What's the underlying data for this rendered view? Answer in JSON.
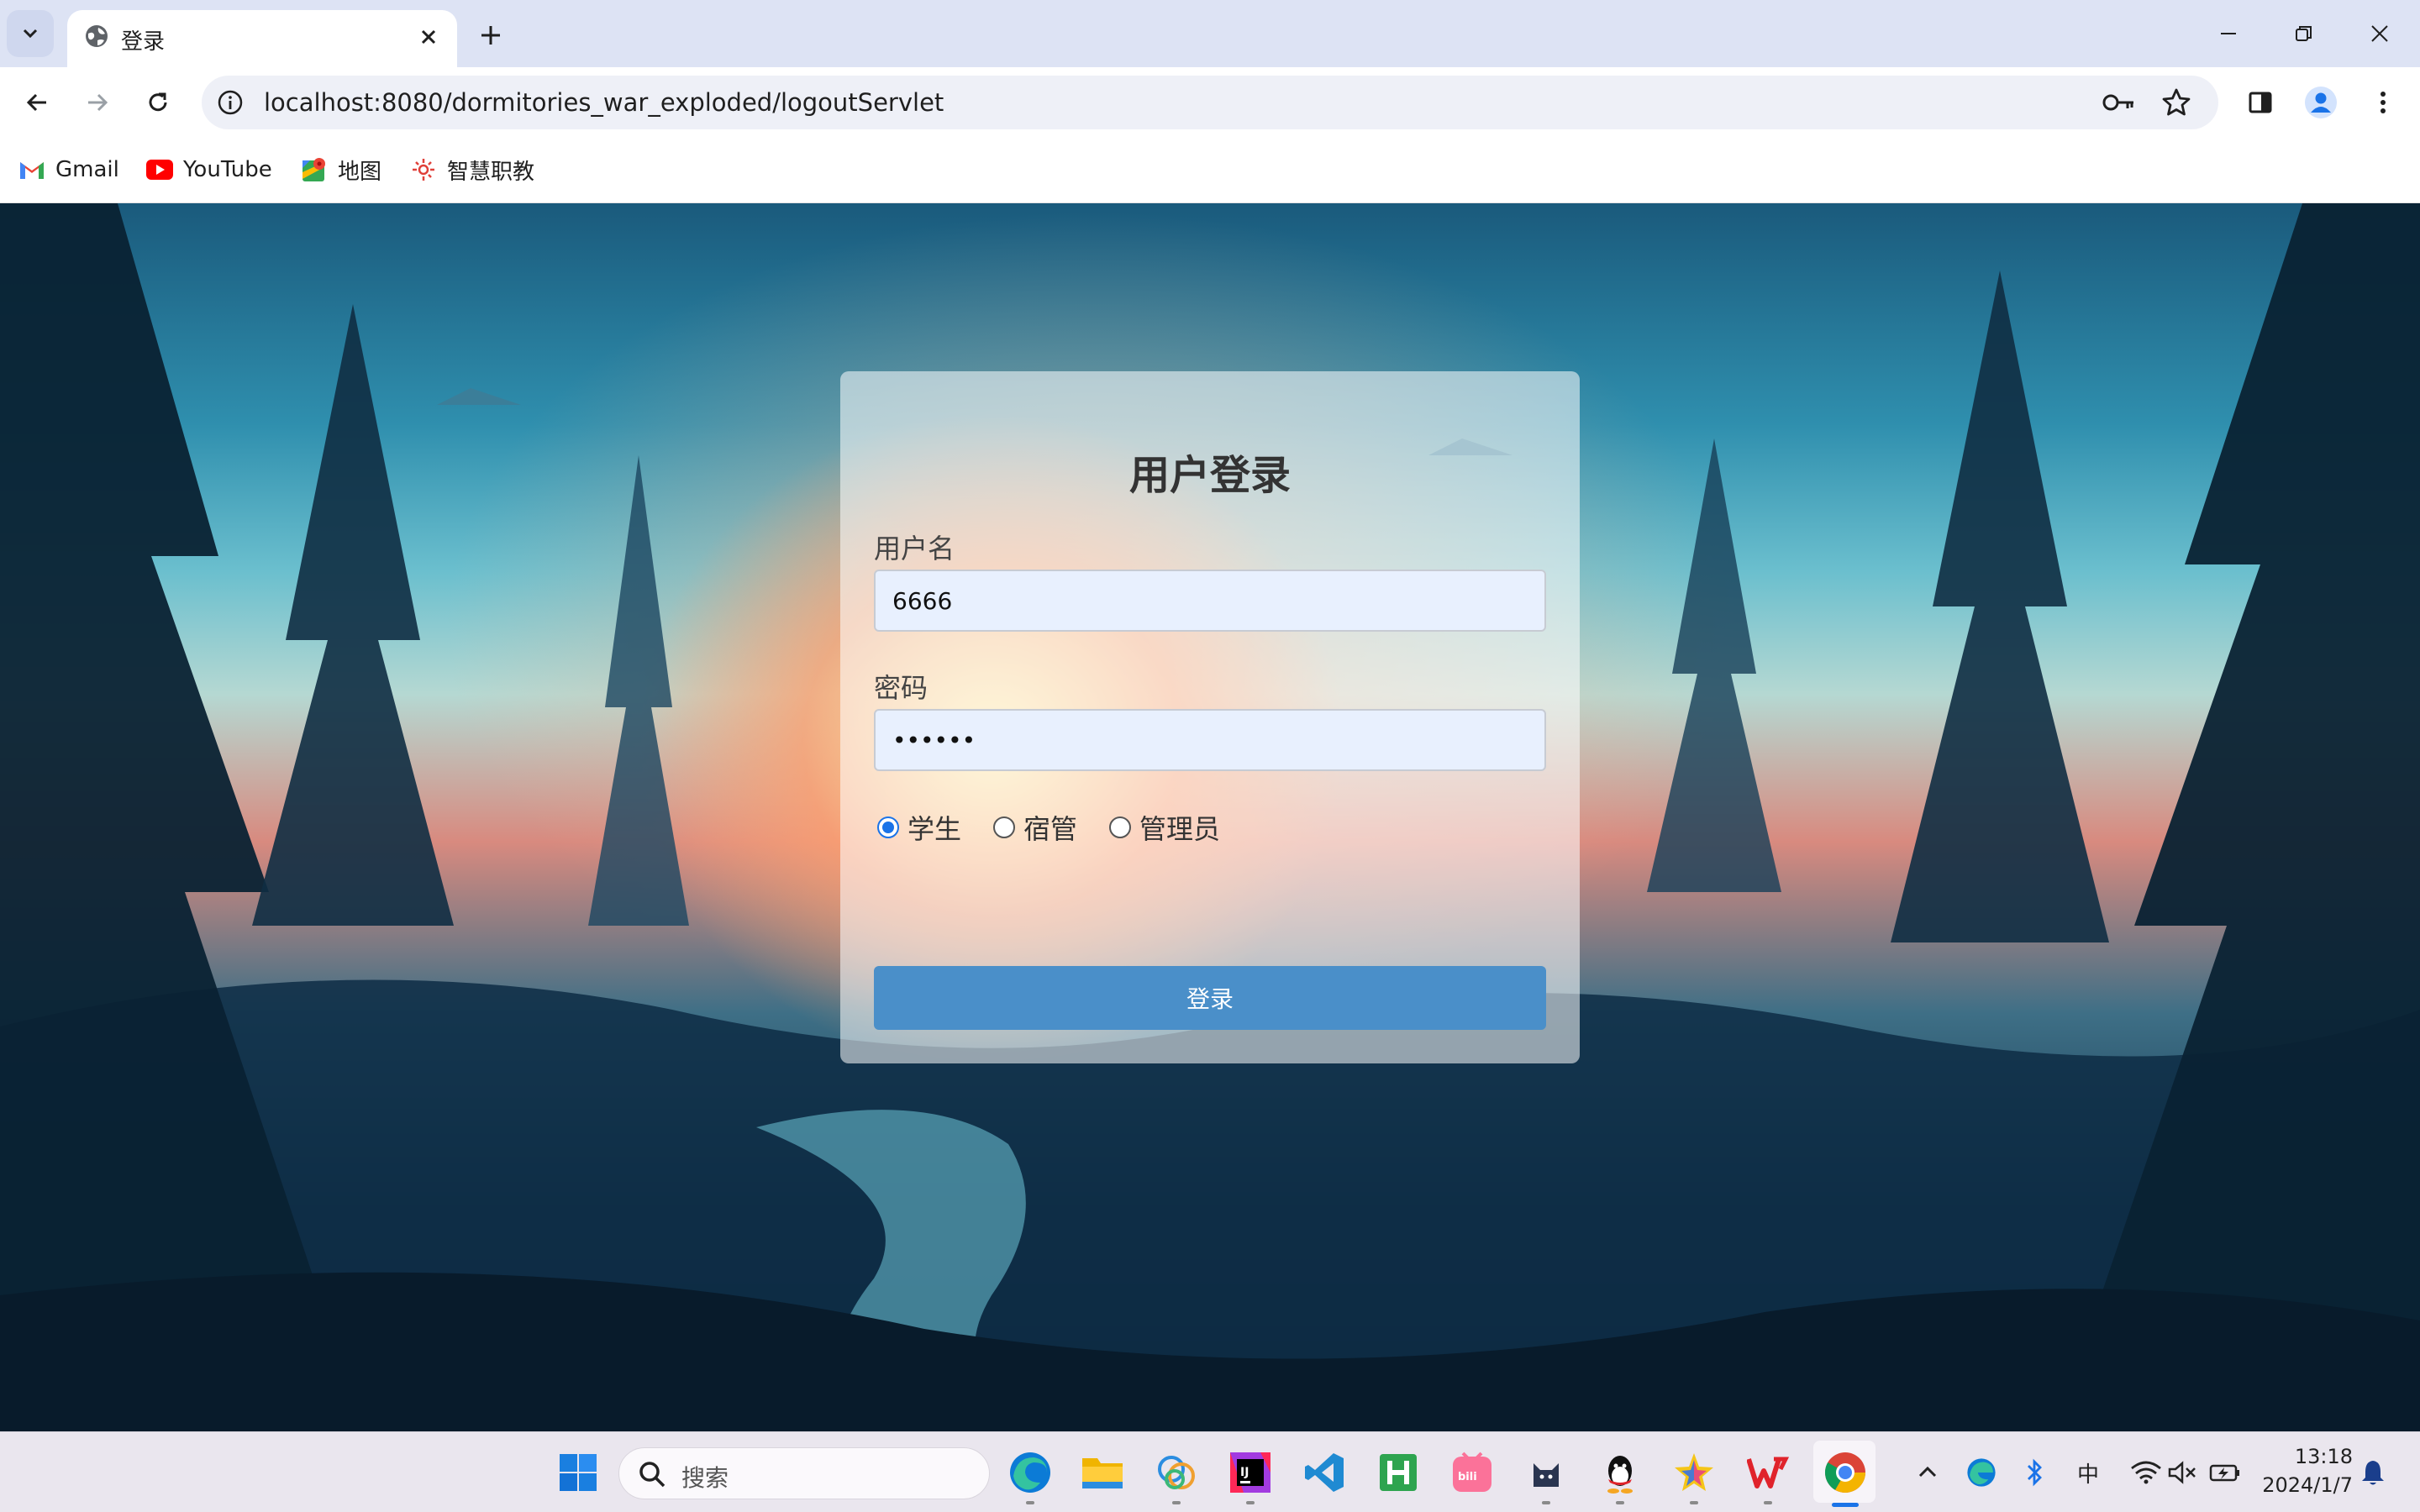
{
  "browser": {
    "tab_title": "登录",
    "url": "localhost:8080/dormitories_war_exploded/logoutServlet",
    "bookmarks": [
      {
        "label": "Gmail",
        "icon": "gmail-icon"
      },
      {
        "label": "YouTube",
        "icon": "youtube-icon"
      },
      {
        "label": "地图",
        "icon": "maps-icon"
      },
      {
        "label": "智慧职教",
        "icon": "zhihuizhijiao-icon"
      }
    ]
  },
  "login": {
    "title": "用户登录",
    "username_label": "用户名",
    "username_value": "6666",
    "password_label": "密码",
    "password_value": "••••••",
    "roles": [
      {
        "label": "学生",
        "checked": true
      },
      {
        "label": "宿管",
        "checked": false
      },
      {
        "label": "管理员",
        "checked": false
      }
    ],
    "submit_label": "登录"
  },
  "taskbar": {
    "search_placeholder": "搜索",
    "ime": "中",
    "time": "13:18",
    "date": "2024/1/7"
  },
  "colors": {
    "accent": "#4a8fc9",
    "radio_checked": "#1a73e8",
    "tabstrip": "#dde3f4"
  }
}
